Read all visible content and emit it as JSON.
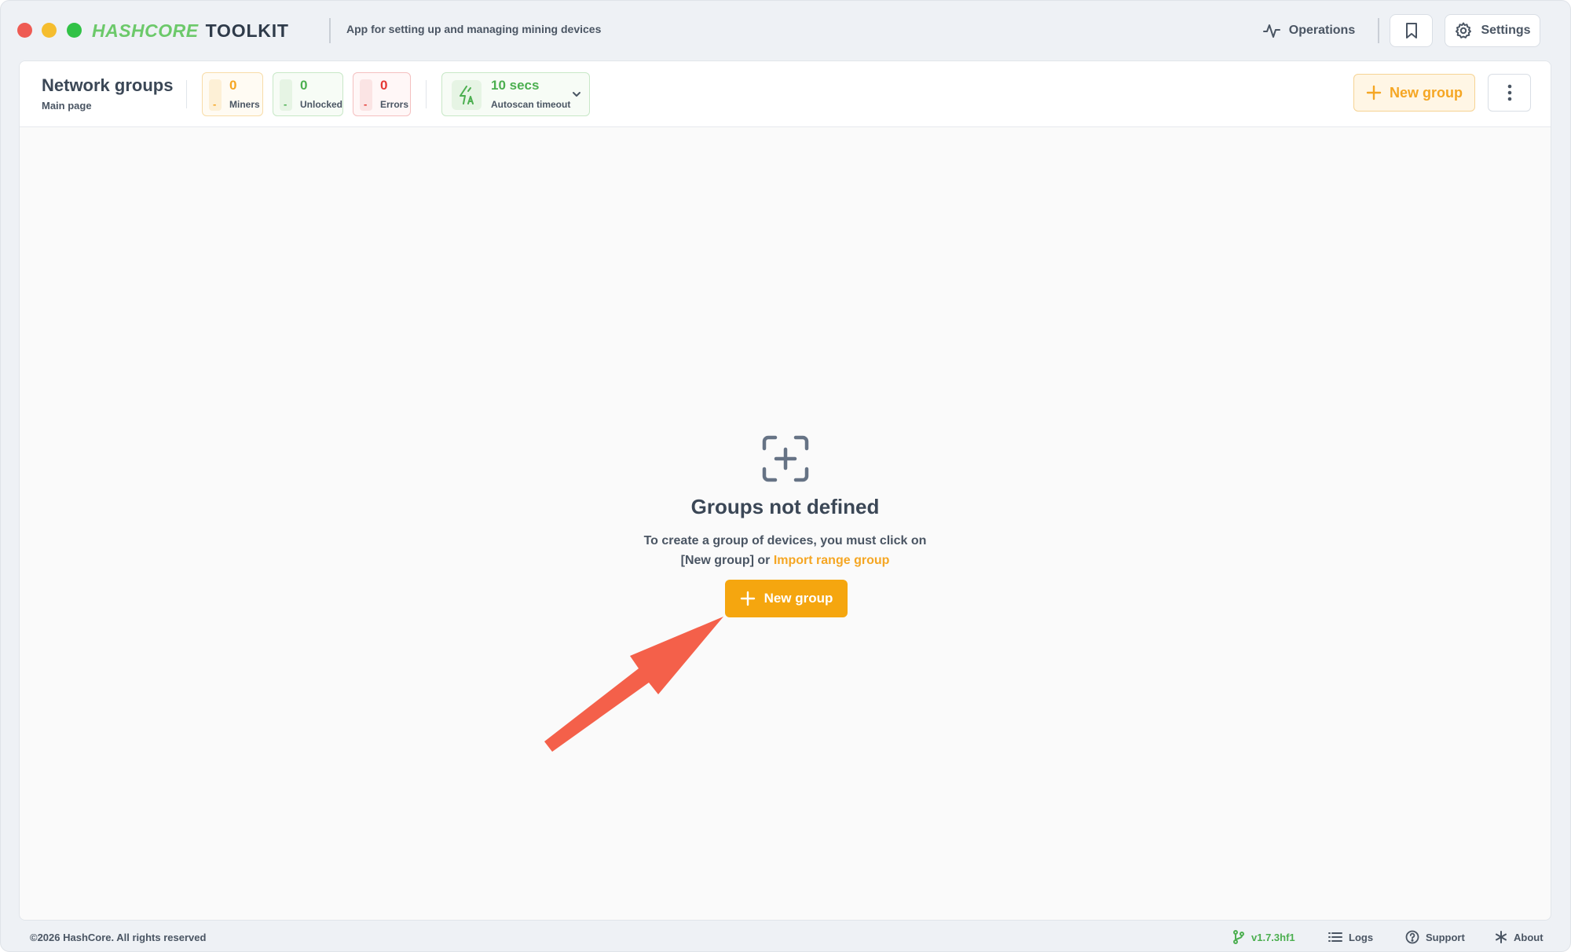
{
  "titlebar": {
    "brand_highlight": "HASHCORE",
    "brand_main": "TOOLKIT",
    "tagline": "App for setting up and managing mining devices",
    "operations_label": "Operations",
    "settings_label": "Settings"
  },
  "header": {
    "title": "Network groups",
    "subtitle": "Main page",
    "stats": {
      "miners": {
        "value": "0",
        "dash": "-",
        "label": "Miners",
        "color": "#f5a623"
      },
      "unlocked": {
        "value": "0",
        "dash": "-",
        "label": "Unlocked",
        "color": "#4caf50"
      },
      "errors": {
        "value": "0",
        "dash": "-",
        "label": "Errors",
        "color": "#e53935"
      }
    },
    "autoscan": {
      "value": "10 secs",
      "label": "Autoscan timeout"
    },
    "new_group_label": "New group"
  },
  "empty_state": {
    "title": "Groups not defined",
    "line1": "To create a group of devices, you must click on",
    "line2_prefix": "[New group] or",
    "import_link": "Import range group",
    "button_label": "New group"
  },
  "footer": {
    "copyright": "©2026 HashCore. All rights reserved",
    "version": "v1.7.3hf1",
    "logs": "Logs",
    "support": "Support",
    "about": "About"
  },
  "colors": {
    "accent": "#f5a60f",
    "success": "#4caf50",
    "error": "#e53935",
    "annotation_arrow": "#f4604a"
  }
}
